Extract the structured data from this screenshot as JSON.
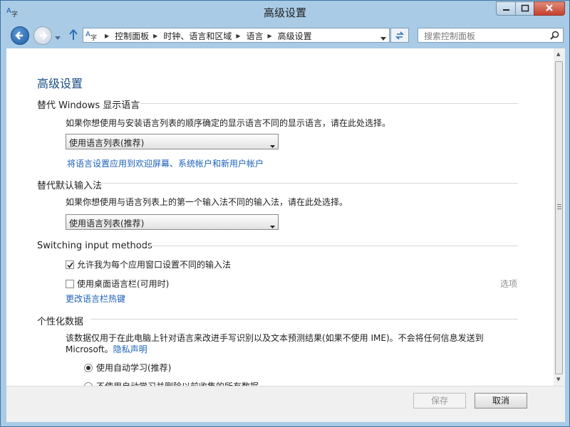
{
  "window": {
    "title": "高级设置"
  },
  "nav": {
    "breadcrumbs": [
      "控制面板",
      "时钟、语言和区域",
      "语言",
      "高级设置"
    ],
    "search_placeholder": "搜索控制面板"
  },
  "page": {
    "title": "高级设置",
    "display_lang": {
      "heading": "替代 Windows 显示语言",
      "description": "如果你想使用与安装语言列表的顺序确定的显示语言不同的显示语言，请在此处选择。",
      "select_value": "使用语言列表(推荐)",
      "link": "将语言设置应用到欢迎屏幕、系统帐户和新用户帐户"
    },
    "input_method": {
      "heading": "替代默认输入法",
      "description": "如果你想使用与语言列表上的第一个输入法不同的输入法，请在此处选择。",
      "select_value": "使用语言列表(推荐)"
    },
    "switching": {
      "heading": "Switching input methods",
      "per_app_label": "允许我为每个应用窗口设置不同的输入法",
      "per_app_checked": true,
      "langbar_label": "使用桌面语言栏(可用时)",
      "langbar_checked": false,
      "options_link": "选项",
      "hotkeys_link": "更改语言栏热键"
    },
    "personalization": {
      "heading": "个性化数据",
      "description_line1": "该数据仅用于在此电脑上针对语言来改进手写识别以及文本预测结果(如果不使用 IME)。不会将任何信息发送到",
      "description_line2": "Microsoft。",
      "privacy_link": "隐私声明",
      "option_auto": "使用自动学习(推荐)",
      "option_no_auto": "不使用自动学习并删除以前收集的所有数据"
    }
  },
  "footer": {
    "save_label": "保存",
    "cancel_label": "取消"
  },
  "colors": {
    "frame": "#a9cbe6",
    "link": "#1c62b9",
    "heading": "#1a4b86"
  }
}
